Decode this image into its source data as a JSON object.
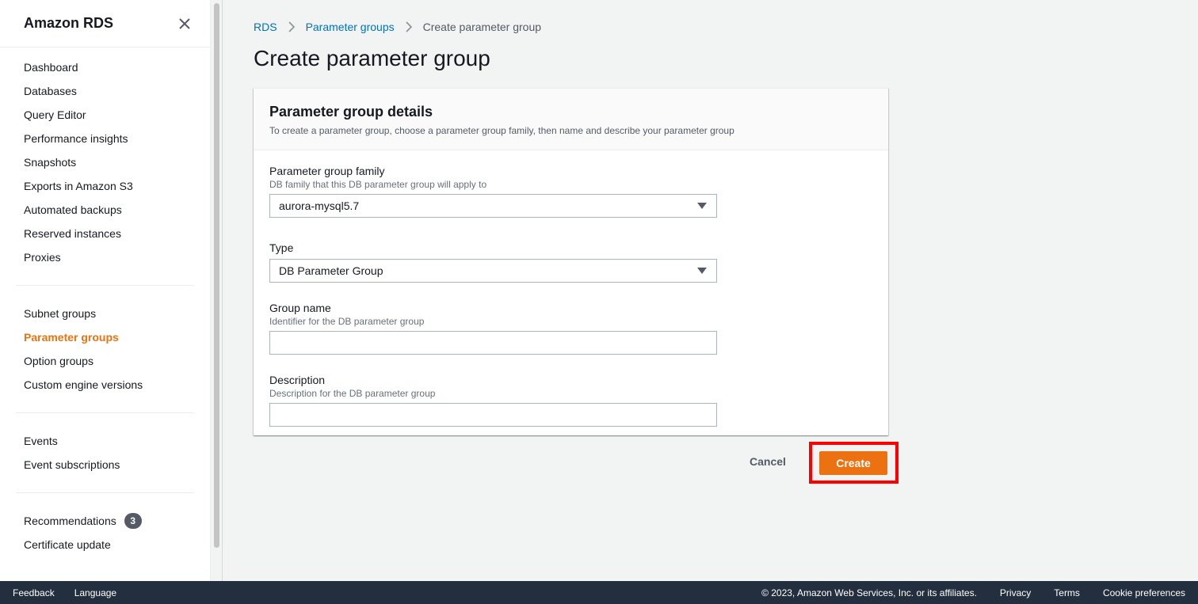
{
  "sidebar": {
    "title": "Amazon RDS",
    "groups": [
      [
        {
          "label": "Dashboard"
        },
        {
          "label": "Databases"
        },
        {
          "label": "Query Editor"
        },
        {
          "label": "Performance insights"
        },
        {
          "label": "Snapshots"
        },
        {
          "label": "Exports in Amazon S3"
        },
        {
          "label": "Automated backups"
        },
        {
          "label": "Reserved instances"
        },
        {
          "label": "Proxies"
        }
      ],
      [
        {
          "label": "Subnet groups"
        },
        {
          "label": "Parameter groups"
        },
        {
          "label": "Option groups"
        },
        {
          "label": "Custom engine versions"
        }
      ],
      [
        {
          "label": "Events"
        },
        {
          "label": "Event subscriptions"
        }
      ],
      [
        {
          "label": "Recommendations",
          "badge": "3"
        },
        {
          "label": "Certificate update"
        }
      ]
    ]
  },
  "breadcrumb": {
    "items": [
      "RDS",
      "Parameter groups"
    ],
    "current": "Create parameter group"
  },
  "page": {
    "title": "Create parameter group"
  },
  "panel": {
    "title": "Parameter group details",
    "subtitle": "To create a parameter group, choose a parameter group family, then name and describe your parameter group",
    "fields": {
      "family": {
        "label": "Parameter group family",
        "description": "DB family that this DB parameter group will apply to",
        "value": "aurora-mysql5.7"
      },
      "type": {
        "label": "Type",
        "value": "DB Parameter Group"
      },
      "group_name": {
        "label": "Group name",
        "description": "Identifier for the DB parameter group",
        "value": ""
      },
      "description": {
        "label": "Description",
        "description": "Description for the DB parameter group",
        "value": ""
      }
    }
  },
  "actions": {
    "cancel": "Cancel",
    "create": "Create"
  },
  "footer": {
    "left": [
      "Feedback",
      "Language"
    ],
    "copyright": "© 2023, Amazon Web Services, Inc. or its affiliates.",
    "right": [
      "Privacy",
      "Terms",
      "Cookie preferences"
    ]
  },
  "colors": {
    "accent": "#ec7211",
    "link": "#0073bb",
    "footer_bg": "#232f3e",
    "highlight": "#ff0000"
  }
}
